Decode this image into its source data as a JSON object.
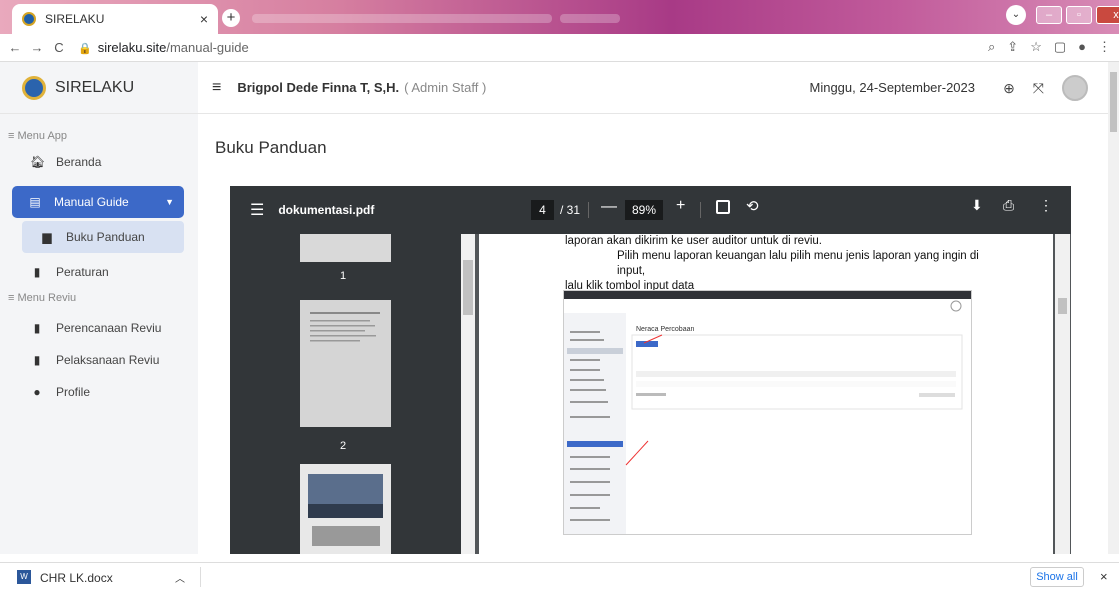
{
  "browser": {
    "tab_title": "SIRELAKU",
    "tab_close": "×",
    "new_tab": "+",
    "url_host": "sirelaku.site",
    "url_path": "/manual-guide",
    "back": "←",
    "forward": "→",
    "reload": "C"
  },
  "app": {
    "brand": "SIRELAKU",
    "menu_toggle": "≡",
    "user_name": "Brigpol Dede Finna T, S,H.",
    "user_role": "( Admin Staff )",
    "date": "Minggu, 24-September-2023"
  },
  "sidebar": {
    "section_app": "≡ Menu App",
    "section_reviu": "≡ Menu Reviu",
    "items": {
      "beranda": "Beranda",
      "manual_guide": "Manual Guide",
      "buku_panduan": "Buku Panduan",
      "peraturan": "Peraturan",
      "perencanaan": "Perencanaan Reviu",
      "pelaksanaan": "Pelaksanaan Reviu",
      "profile": "Profile"
    }
  },
  "main": {
    "title": "Buku Panduan"
  },
  "viewer": {
    "file_name": "dokumentasi.pdf",
    "page_current": "4",
    "page_total": "/ 31",
    "zoom": "89%",
    "thumbnail_labels": [
      "1",
      "2"
    ]
  },
  "document": {
    "line1": "laporan akan dikirim ke user auditor untuk di reviu.",
    "line2": "Pilih menu laporan keuangan lalu pilih menu jenis laporan yang ingin di input,",
    "line3": "lalu klik tombol input data",
    "embedded_title": "Neraca Percobaan"
  },
  "downloads": {
    "file_name": "CHR LK.docx",
    "show_all": "Show all",
    "close": "×"
  },
  "colors": {
    "accent": "#3c69c8",
    "sidebar_bg": "#f4f5f7",
    "viewer_toolbar": "#323639",
    "viewer_bg": "#525659"
  }
}
